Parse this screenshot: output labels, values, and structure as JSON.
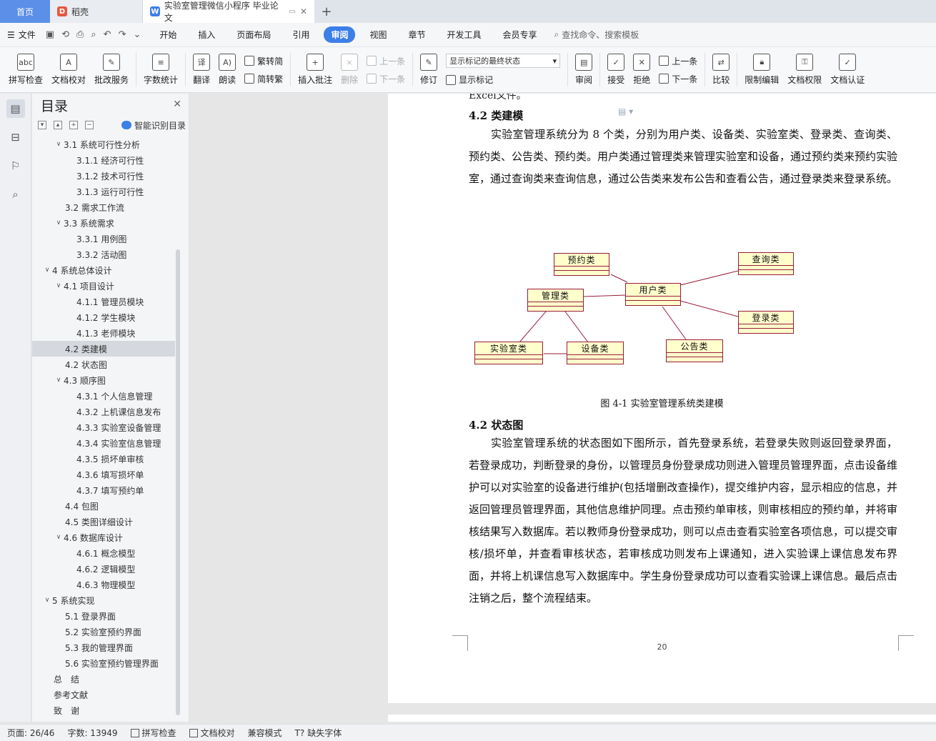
{
  "tabs": {
    "home": "首页",
    "daoke": "稻壳",
    "doc_title": "实验室管理微信小程序 毕业论文"
  },
  "menu": {
    "file": "文件",
    "items": [
      "开始",
      "插入",
      "页面布局",
      "引用",
      "审阅",
      "视图",
      "章节",
      "开发工具",
      "会员专享"
    ],
    "active": "审阅",
    "search": "查找命令、搜索模板"
  },
  "ribbon": {
    "spell": "拼写检查",
    "doc_check": "文档校对",
    "batch": "批改服务",
    "word_count": "字数统计",
    "translate": "翻译",
    "read": "朗读",
    "trad": "繁转简",
    "simp": "简转繁",
    "insert_comment": "插入批注",
    "delete": "删除",
    "prev": "上一条",
    "next": "下一条",
    "revise": "修订",
    "display_state": "显示标记的最终状态",
    "show_marks": "显示标记",
    "review": "审阅",
    "accept": "接受",
    "reject": "拒绝",
    "prev2": "上一条",
    "next2": "下一条",
    "compare": "比较",
    "restrict": "限制编辑",
    "permission": "文档权限",
    "certify": "文档认证"
  },
  "toc": {
    "title": "目录",
    "smart": "智能识别目录",
    "items": [
      {
        "text": "3.1 系统可行性分析",
        "level": 2,
        "arrow": "v"
      },
      {
        "text": "3.1.1 经济可行性",
        "level": 3
      },
      {
        "text": "3.1.2 技术可行性",
        "level": 3
      },
      {
        "text": "3.1.3 运行可行性",
        "level": 3
      },
      {
        "text": "3.2 需求工作流",
        "level": 2
      },
      {
        "text": "3.3 系统需求",
        "level": 2,
        "arrow": "v"
      },
      {
        "text": "3.3.1 用例图",
        "level": 3
      },
      {
        "text": "3.3.2 活动图",
        "level": 3
      },
      {
        "text": "4 系统总体设计",
        "level": 1,
        "arrow": "v"
      },
      {
        "text": "4.1 项目设计",
        "level": 2,
        "arrow": "v"
      },
      {
        "text": "4.1.1 管理员模块",
        "level": 3
      },
      {
        "text": "4.1.2 学生模块",
        "level": 3
      },
      {
        "text": "4.1.3 老师模块",
        "level": 3
      },
      {
        "text": "4.2 类建模",
        "level": 2,
        "selected": true
      },
      {
        "text": "4.2  状态图",
        "level": 2
      },
      {
        "text": "4.3  顺序图",
        "level": 2,
        "arrow": "v"
      },
      {
        "text": "4.3.1 个人信息管理",
        "level": 3
      },
      {
        "text": "4.3.2 上机课信息发布",
        "level": 3
      },
      {
        "text": "4.3.3 实验室设备管理",
        "level": 3
      },
      {
        "text": "4.3.4 实验室信息管理",
        "level": 3
      },
      {
        "text": "4.3.5 损坏单审核",
        "level": 3
      },
      {
        "text": "4.3.6 填写损坏单",
        "level": 3
      },
      {
        "text": "4.3.7 填写预约单",
        "level": 3
      },
      {
        "text": "4.4  包图",
        "level": 2
      },
      {
        "text": "4.5 类图详细设计",
        "level": 2
      },
      {
        "text": "4.6  数据库设计",
        "level": 2,
        "arrow": "v"
      },
      {
        "text": "4.6.1  概念模型",
        "level": 3
      },
      {
        "text": "4.6.2  逻辑模型",
        "level": 3
      },
      {
        "text": "4.6.3  物理模型",
        "level": 3
      },
      {
        "text": "5 系统实现",
        "level": 1,
        "arrow": "v"
      },
      {
        "text": "5.1 登录界面",
        "level": 2
      },
      {
        "text": "5.2  实验室预约界面",
        "level": 2
      },
      {
        "text": "5.3  我的管理界面",
        "level": 2
      },
      {
        "text": "5.6  实验室预约管理界面",
        "level": 2
      },
      {
        "text": "总　结",
        "level": 1
      },
      {
        "text": "参考文献",
        "level": 1
      },
      {
        "text": "致　谢",
        "level": 1
      }
    ]
  },
  "document": {
    "cut_line": "Excel文件。",
    "h1": "4.2 类建模",
    "p1": "实验室管理系统分为 8 个类，分别为用户类、设备类、实验室类、登录类、查询类、预约类、公告类、预约类。用户类通过管理类来管理实验室和设备，通过预约类来预约实验室，通过查询类来查询信息，通过公告类来发布公告和查看公告，通过登录类来登录系统。",
    "caption": "图 4-1  实验室管理系统类建模",
    "h2": "4.2  状态图",
    "p2": "实验室管理系统的状态图如下图所示，首先登录系统，若登录失败则返回登录界面，若登录成功，判断登录的身份，以管理员身份登录成功则进入管理员管理界面，点击设备维护可以对实验室的设备进行维护(包括增删改查操作)，提交维护内容，显示相应的信息，并返回管理员管理界面，其他信息维护同理。点击预约单审核，则审核相应的预约单，并将审核结果写入数据库。若以教师身份登录成功，则可以点击查看实验室各项信息，可以提交审核/损坏单，并查看审核状态，若审核成功则发布上课通知，进入实验课上课信息发布界面，并将上机课信息写入数据库中。学生身份登录成功可以查看实验课上课信息。最后点击注销之后，整个流程结束。",
    "page_number": "20"
  },
  "diagram": {
    "classes": {
      "yuyue": "预约类",
      "chaxun": "查询类",
      "guanli": "管理类",
      "yonghu": "用户类",
      "denglu": "登录类",
      "shiyanshi": "实验室类",
      "shebei": "设备类",
      "gonggao": "公告类"
    }
  },
  "status": {
    "page": "页面: 26/46",
    "words": "字数: 13949",
    "spell": "拼写检查",
    "check": "文档校对",
    "compat": "兼容模式",
    "font": "缺失字体"
  },
  "colors": {
    "accent": "#3d7fe8",
    "uml_fill": "#ffffcc",
    "uml_border": "#9a1b3a"
  }
}
